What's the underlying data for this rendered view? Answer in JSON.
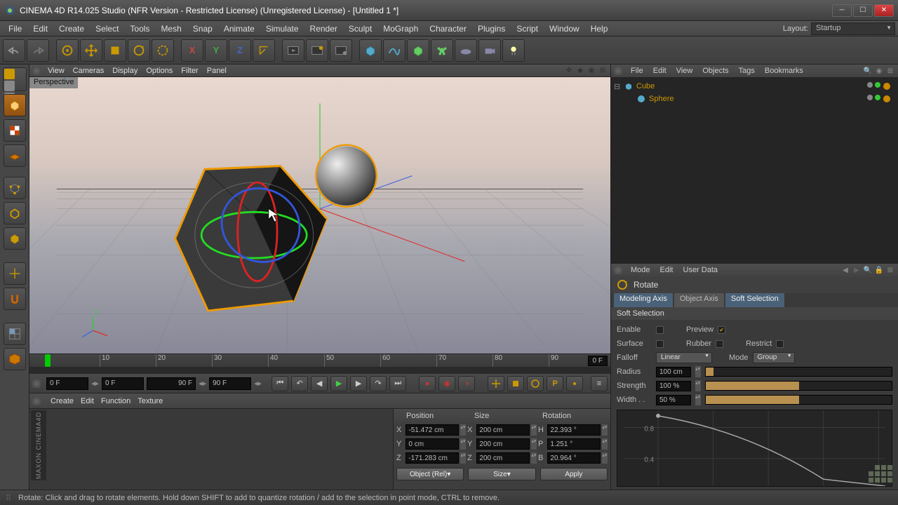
{
  "titlebar": {
    "text": "CINEMA 4D R14.025 Studio (NFR Version - Restricted License) (Unregistered License) - [Untitled 1 *]"
  },
  "menubar": {
    "items": [
      "File",
      "Edit",
      "Create",
      "Select",
      "Tools",
      "Mesh",
      "Snap",
      "Animate",
      "Simulate",
      "Render",
      "Sculpt",
      "MoGraph",
      "Character",
      "Plugins",
      "Script",
      "Window",
      "Help"
    ],
    "layout_label": "Layout:",
    "layout_value": "Startup"
  },
  "viewport_menu": {
    "items": [
      "View",
      "Cameras",
      "Display",
      "Options",
      "Filter",
      "Panel"
    ],
    "label": "Perspective"
  },
  "timeline": {
    "marks": [
      "10",
      "20",
      "30",
      "40",
      "50",
      "60",
      "70",
      "80",
      "90"
    ],
    "end_frame": "0 F"
  },
  "transport": {
    "f0": "0 F",
    "f1": "0 F",
    "f2": "90 F",
    "f3": "90 F"
  },
  "material_menu": {
    "items": [
      "Create",
      "Edit",
      "Function",
      "Texture"
    ]
  },
  "coords": {
    "headers": [
      "Position",
      "Size",
      "Rotation"
    ],
    "pos": {
      "x": "-51.472 cm",
      "y": "0 cm",
      "z": "-171.283 cm"
    },
    "size": {
      "x": "200 cm",
      "y": "200 cm",
      "z": "200 cm"
    },
    "rot": {
      "h": "22.393 °",
      "p": "1.251 °",
      "b": "20.964 °"
    },
    "object_btn": "Object (Rel)",
    "size_btn": "Size",
    "apply_btn": "Apply"
  },
  "obj_panel": {
    "menu": [
      "File",
      "Edit",
      "View",
      "Objects",
      "Tags",
      "Bookmarks"
    ],
    "tree": [
      {
        "name": "Cube",
        "indent": 0
      },
      {
        "name": "Sphere",
        "indent": 1
      }
    ]
  },
  "attr_panel": {
    "menu": [
      "Mode",
      "Edit",
      "User Data"
    ],
    "tool": "Rotate",
    "tabs": [
      "Modeling Axis",
      "Object Axis",
      "Soft Selection"
    ],
    "section": "Soft Selection",
    "enable_label": "Enable",
    "preview_label": "Preview",
    "surface_label": "Surface",
    "rubber_label": "Rubber",
    "restrict_label": "Restrict",
    "falloff_label": "Falloff",
    "falloff_value": "Linear",
    "mode_label": "Mode",
    "mode_value": "Group",
    "radius_label": "Radius",
    "radius_value": "100 cm",
    "strength_label": "Strength",
    "strength_value": "100 %",
    "width_label": "Width . .",
    "width_value": "50 %",
    "curve_y1": "0.8",
    "curve_y2": "0.4"
  },
  "statusbar": {
    "text": "Rotate: Click and drag to rotate elements. Hold down SHIFT to add to quantize rotation / add to the selection in point mode, CTRL to remove."
  },
  "logo_text": "MAXON CINEMA4D"
}
